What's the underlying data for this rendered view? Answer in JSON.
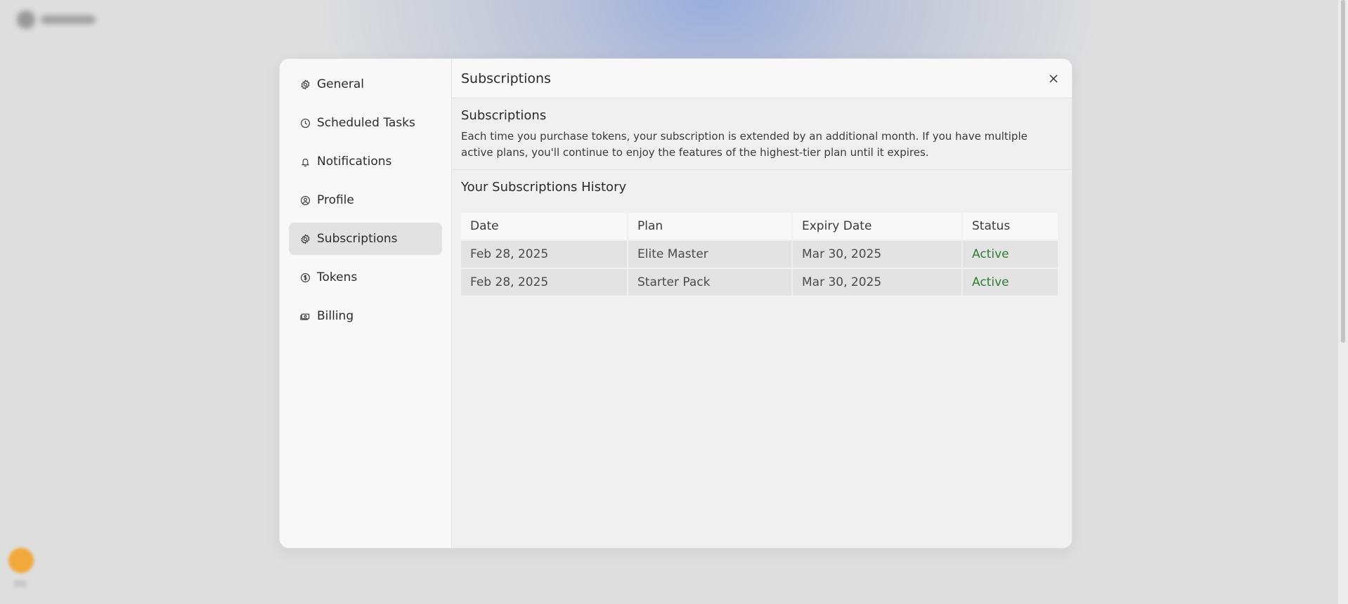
{
  "modal": {
    "title": "Subscriptions"
  },
  "sidebar": {
    "items": [
      {
        "label": "General",
        "icon": "gear-icon"
      },
      {
        "label": "Scheduled Tasks",
        "icon": "clock-icon"
      },
      {
        "label": "Notifications",
        "icon": "bell-icon"
      },
      {
        "label": "Profile",
        "icon": "user-circle-icon"
      },
      {
        "label": "Subscriptions",
        "icon": "badge-icon",
        "active": true
      },
      {
        "label": "Tokens",
        "icon": "coin-icon"
      },
      {
        "label": "Billing",
        "icon": "cash-icon"
      }
    ]
  },
  "intro": {
    "heading": "Subscriptions",
    "description": "Each time you purchase tokens, your subscription is extended by an additional month. If you have multiple active plans, you'll continue to enjoy the features of the highest-tier plan until it expires."
  },
  "history": {
    "heading": "Your Subscriptions History",
    "columns": [
      "Date",
      "Plan",
      "Expiry Date",
      "Status"
    ],
    "rows": [
      {
        "date": "Feb 28, 2025",
        "plan": "Elite Master",
        "expiry": "Mar 30, 2025",
        "status": "Active"
      },
      {
        "date": "Feb 28, 2025",
        "plan": "Starter Pack",
        "expiry": "Mar 30, 2025",
        "status": "Active"
      }
    ]
  },
  "colors": {
    "status_active": "#2e7d32",
    "sidebar_active_bg": "#e2e2e2"
  }
}
